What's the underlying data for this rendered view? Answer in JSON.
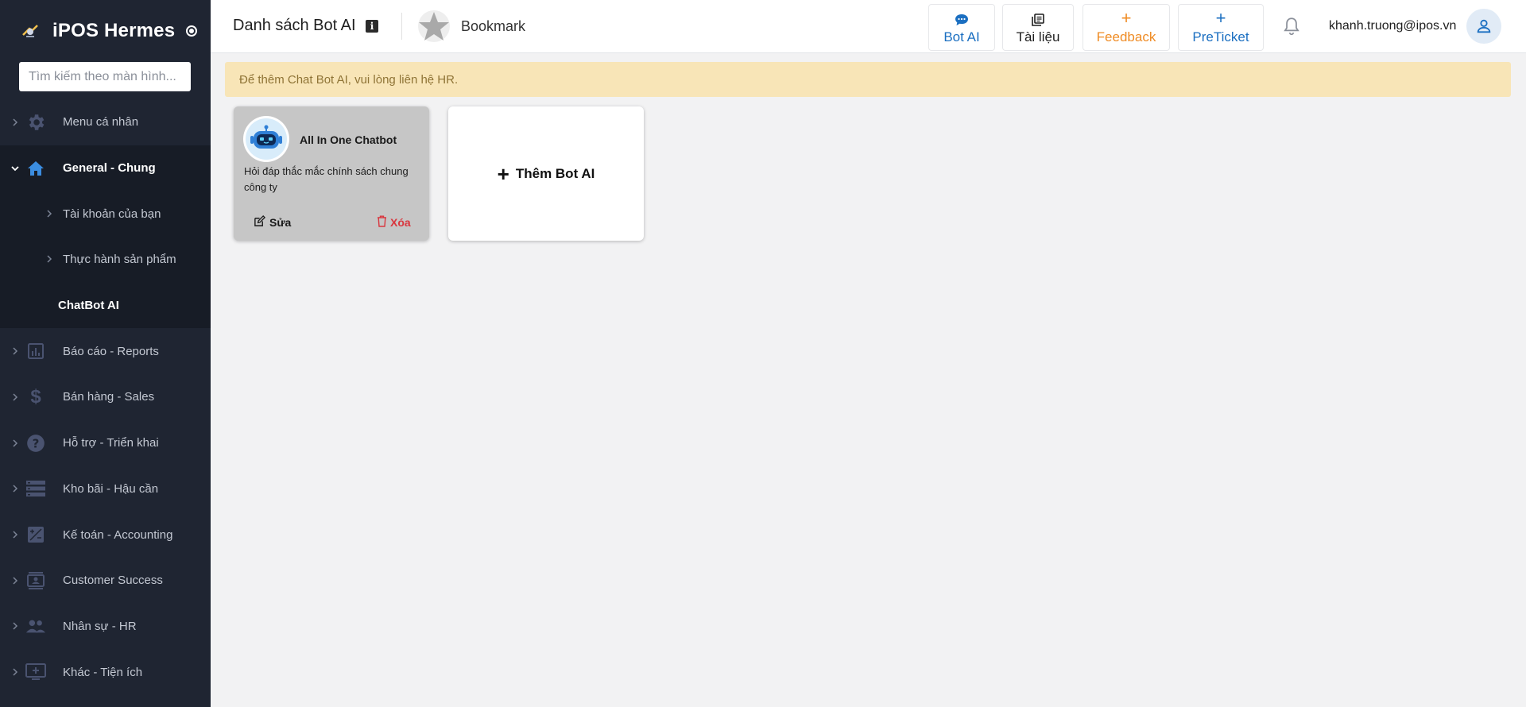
{
  "app": {
    "name": "iPOS Hermes"
  },
  "sidebar": {
    "search_placeholder": "Tìm kiếm theo màn hình...",
    "items": [
      {
        "label": "Menu cá nhân",
        "icon": "gear-icon"
      },
      {
        "label": "General - Chung",
        "icon": "home-icon",
        "expanded": true,
        "children": [
          {
            "label": "Tài khoản của bạn"
          },
          {
            "label": "Thực hành sản phẩm"
          },
          {
            "label": "ChatBot AI",
            "current": true
          }
        ]
      },
      {
        "label": "Báo cáo - Reports",
        "icon": "bar-chart-icon"
      },
      {
        "label": "Bán hàng - Sales",
        "icon": "dollar-icon"
      },
      {
        "label": "Hỗ trợ - Triển khai",
        "icon": "help-icon"
      },
      {
        "label": "Kho bãi - Hậu cần",
        "icon": "storage-icon"
      },
      {
        "label": "Kế toán - Accounting",
        "icon": "calculator-icon"
      },
      {
        "label": "Customer Success",
        "icon": "contact-card-icon"
      },
      {
        "label": "Nhân sự - HR",
        "icon": "people-icon"
      },
      {
        "label": "Khác - Tiện ích",
        "icon": "add-screen-icon"
      }
    ]
  },
  "header": {
    "title": "Danh sách Bot AI",
    "bookmark_label": "Bookmark",
    "buttons": {
      "bot_ai": "Bot AI",
      "docs": "Tài liệu",
      "feedback": "Feedback",
      "preticket": "PreTicket"
    },
    "user_email": "khanh.truong@ipos.vn"
  },
  "main": {
    "notice": "Để thêm Chat Bot AI, vui lòng liên hệ HR.",
    "bots": [
      {
        "name": "All In One Chatbot",
        "description": "Hỏi đáp thắc mắc chính sách chung công ty",
        "edit_label": "Sửa",
        "delete_label": "Xóa"
      }
    ],
    "add_label": "Thêm Bot AI"
  },
  "colors": {
    "sidebar_bg": "#1f2532",
    "accent_blue": "#1b6fc1",
    "feedback_orange": "#ef8c25",
    "danger_red": "#d9363e",
    "notice_bg": "#f8e5b7"
  }
}
